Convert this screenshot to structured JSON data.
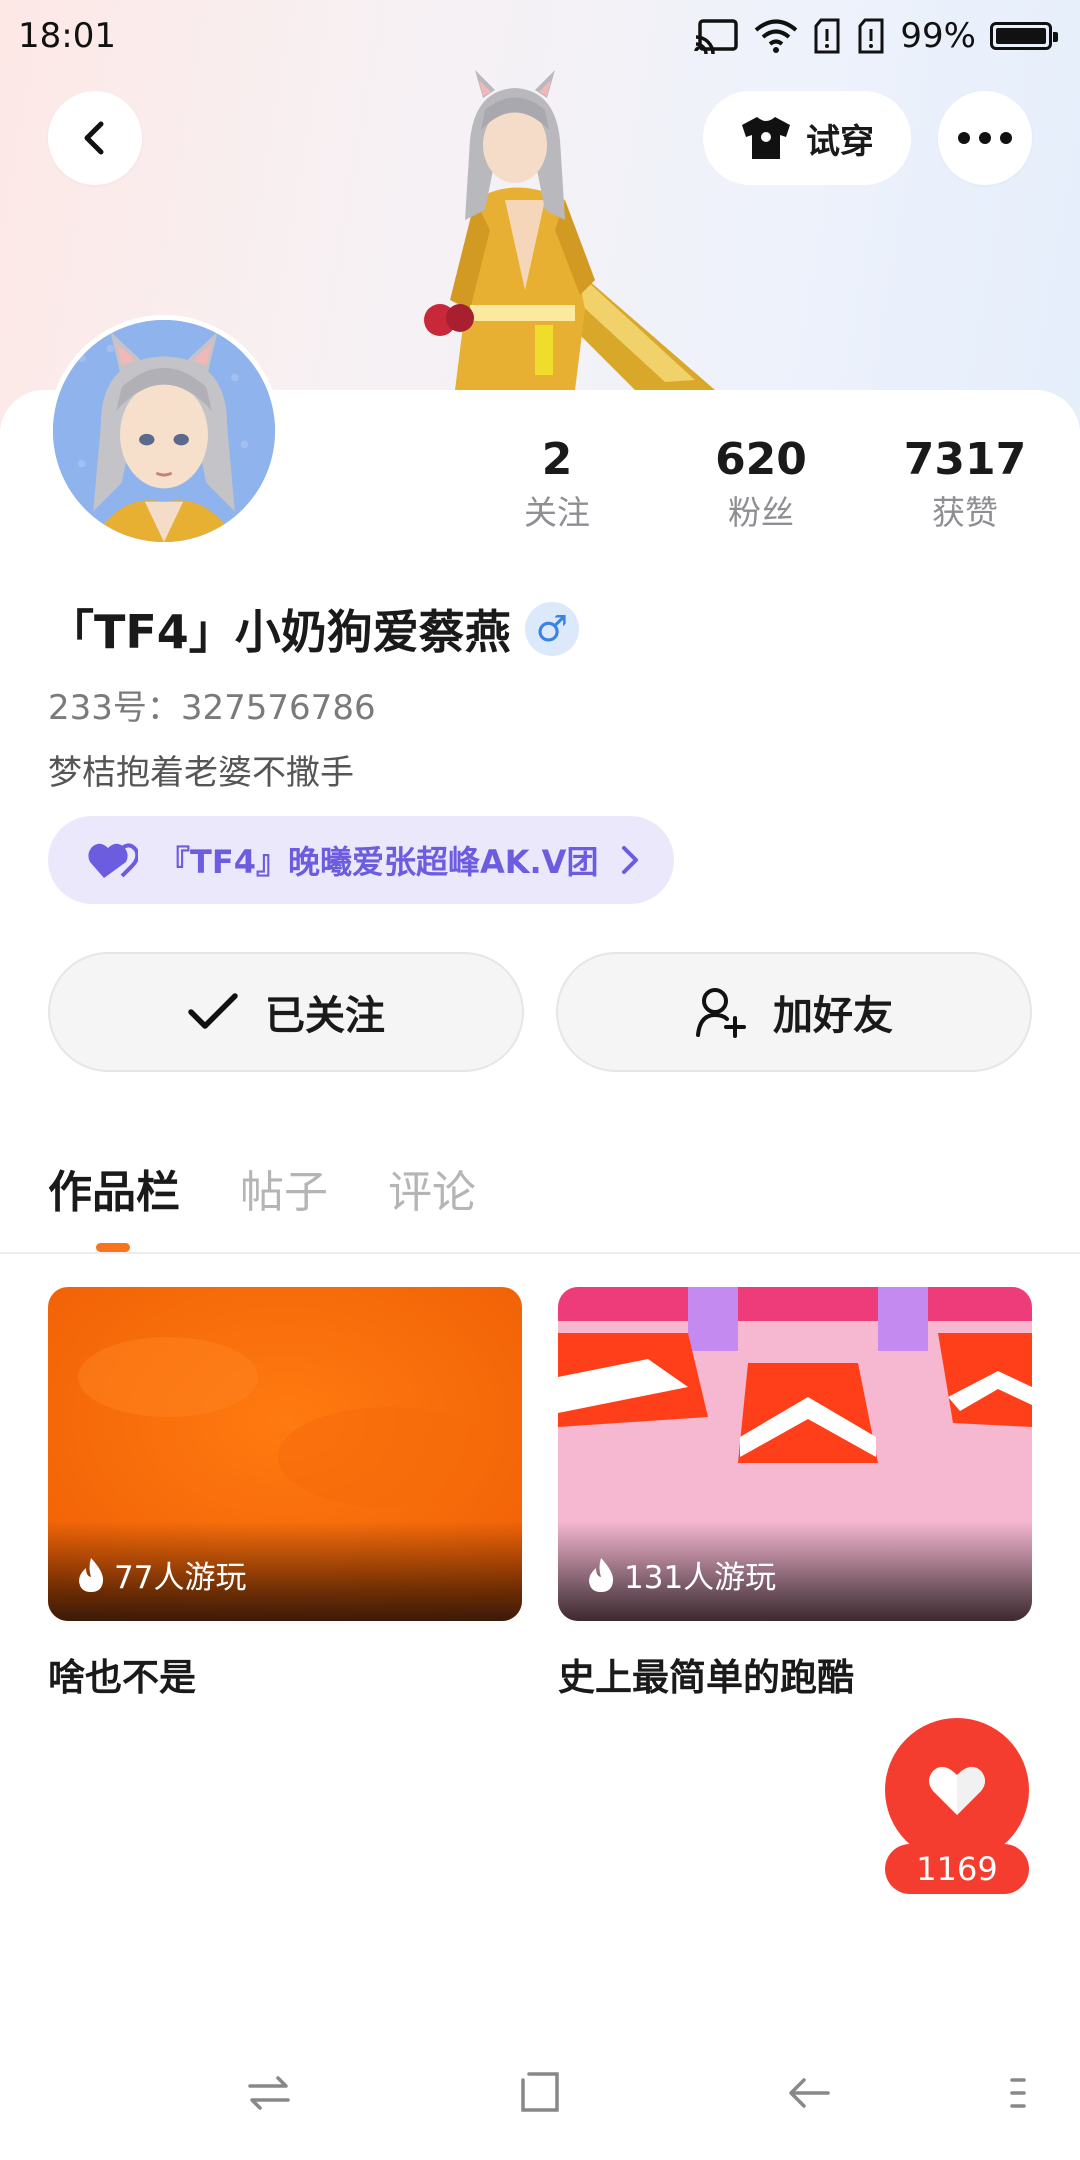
{
  "status_bar": {
    "time": "18:01",
    "battery": "99%",
    "battery_level": 0.99,
    "icons": [
      "cast-icon",
      "wifi-icon",
      "sim-alert-icon",
      "sim-alert-icon",
      "battery-icon"
    ]
  },
  "header": {
    "try_on_label": "试穿"
  },
  "profile": {
    "stats": [
      {
        "value": "2",
        "label": "关注"
      },
      {
        "value": "620",
        "label": "粉丝"
      },
      {
        "value": "7317",
        "label": "获赞"
      }
    ],
    "username": "「TF4」小奶狗爱蔡燕",
    "gender_symbol": "♂",
    "id_line": "233号：327576786",
    "bio": "梦桔抱着老婆不撒手",
    "group_label": "『TF4』晚曦爱张超峰AK.V团",
    "follow_label": "已关注",
    "add_friend_label": "加好友"
  },
  "tabs": [
    {
      "label": "作品栏",
      "active": true
    },
    {
      "label": "帖子",
      "active": false
    },
    {
      "label": "评论",
      "active": false
    }
  ],
  "works": [
    {
      "title": "啥也不是",
      "plays": "77人游玩"
    },
    {
      "title": "史上最简单的跑酷",
      "plays": "131人游玩"
    }
  ],
  "like": {
    "count": "1169"
  },
  "colors": {
    "accent_orange": "#f5741d",
    "like_red": "#f53d2f",
    "group_purple": "#6b5ce0",
    "group_bg": "#ebe8fb"
  }
}
